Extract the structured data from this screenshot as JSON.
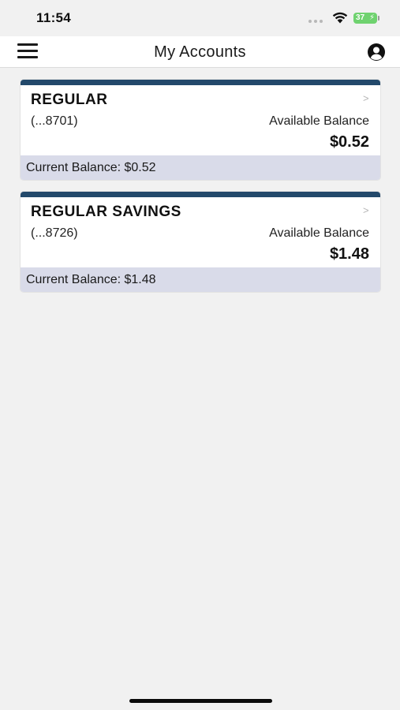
{
  "status_bar": {
    "time": "11:54",
    "battery": "37"
  },
  "nav": {
    "title": "My Accounts",
    "menu_icon": "hamburger-menu-icon",
    "profile_icon": "user-circle-icon"
  },
  "accounts": [
    {
      "name": "REGULAR",
      "number": "(...8701)",
      "available_label": "Available Balance",
      "available_balance": "$0.52",
      "current_balance": "Current Balance: $0.52"
    },
    {
      "name": "REGULAR SAVINGS",
      "number": "(...8726)",
      "available_label": "Available Balance",
      "available_balance": "$1.48",
      "current_balance": "Current Balance: $1.48"
    }
  ],
  "colors": {
    "card_accent": "#23496b",
    "footer_bg": "#d9dbe9",
    "battery": "#6fd26f"
  }
}
